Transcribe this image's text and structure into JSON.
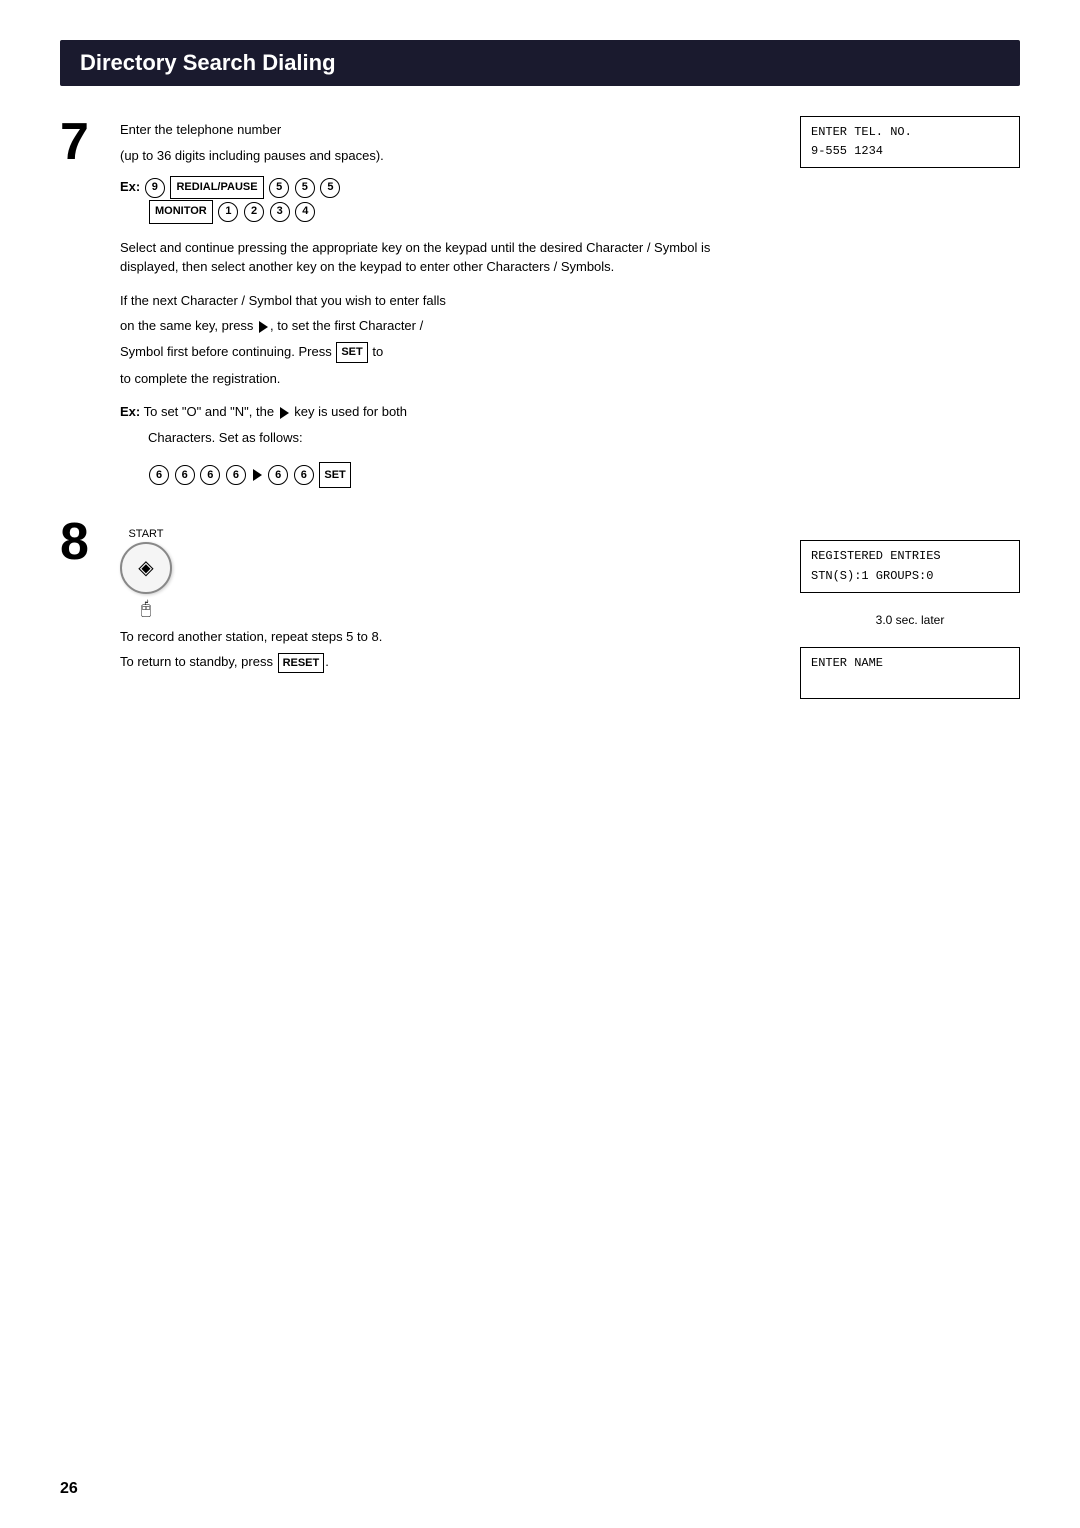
{
  "page": {
    "number": "26",
    "title": "Directory Search Dialing"
  },
  "step7": {
    "number": "7",
    "instruction_line1": "Enter the telephone number",
    "instruction_line2": "(up to 36 digits including pauses and spaces).",
    "example_label": "Ex:",
    "example_keys": [
      "9",
      "REDIAL/PAUSE",
      "5",
      "5",
      "5",
      "MONITOR",
      "1",
      "2",
      "3",
      "4"
    ],
    "description": "Select and continue pressing the appropriate key on the keypad until the desired Character / Symbol is displayed, then select another key on the keypad to enter other Characters / Symbols.",
    "description2": "If the next Character / Symbol that you wish to enter falls on the same key, press",
    "description3": ", to set the first Character /",
    "description4": "Symbol first before continuing. Press",
    "set_key": "SET",
    "description5": "to complete the registration.",
    "ex2_label": "Ex:",
    "ex2_text": "To set \"O\" and \"N\", the",
    "ex2_text2": "key is used for both Characters.  Set as follows:",
    "seq_keys": [
      "6",
      "6",
      "6",
      "6",
      "▶",
      "6",
      "6",
      "SET"
    ],
    "lcd_line1": "ENTER TEL. NO.",
    "lcd_line2": "9-555 1234"
  },
  "step8": {
    "number": "8",
    "start_label": "START",
    "start_symbol": "◈",
    "instruction1": "To record another station, repeat steps 5 to 8.",
    "instruction2": "To return to standby, press",
    "reset_key": "RESET",
    "lcd1_line1": "REGISTERED ENTRIES",
    "lcd1_line2": "STN(S):1   GROUPS:0",
    "sec_later": "3.0 sec. later",
    "lcd2_line1": "ENTER NAME"
  }
}
